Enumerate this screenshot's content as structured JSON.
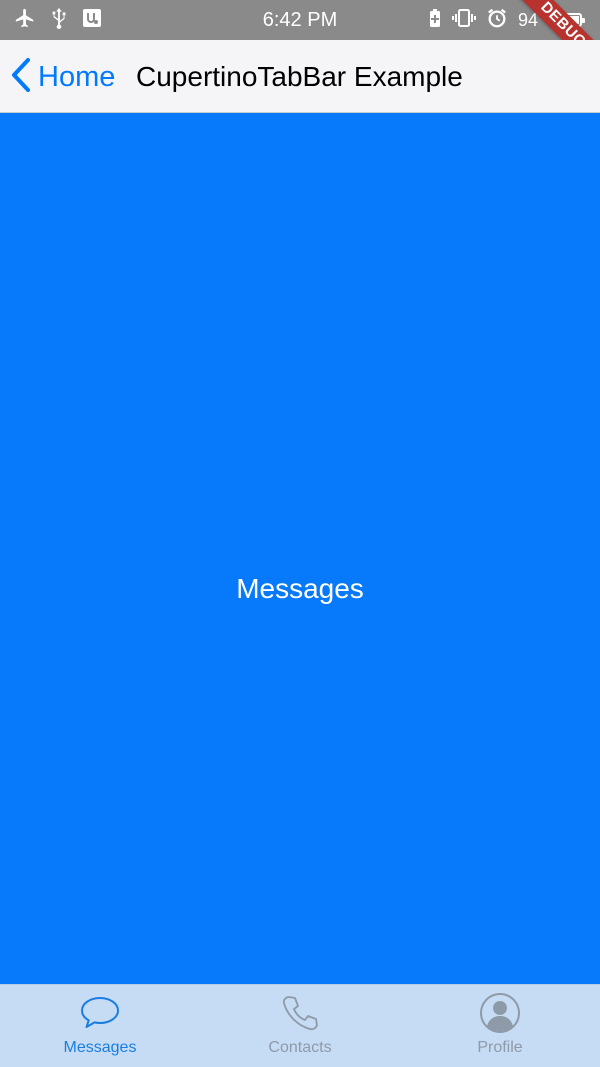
{
  "status_bar": {
    "time": "6:42 PM",
    "battery_percent": "94",
    "icons_left": [
      "airplane-icon",
      "usb-icon",
      "usb-debug-icon"
    ],
    "icons_right": [
      "battery-saver-icon",
      "vibrate-icon",
      "alarm-icon",
      "battery-icon"
    ]
  },
  "debug_ribbon": {
    "label": "DEBUG"
  },
  "nav": {
    "back_label": "Home",
    "title": "CupertinoTabBar Example"
  },
  "content": {
    "label": "Messages",
    "background": "#0779fb"
  },
  "tab_bar": {
    "active_color": "#1a7ee0",
    "inactive_color": "#8e9aa8",
    "tabs": [
      {
        "label": "Messages",
        "icon": "chat-bubble-icon",
        "active": true
      },
      {
        "label": "Contacts",
        "icon": "phone-icon",
        "active": false
      },
      {
        "label": "Profile",
        "icon": "person-circle-icon",
        "active": false
      }
    ]
  }
}
